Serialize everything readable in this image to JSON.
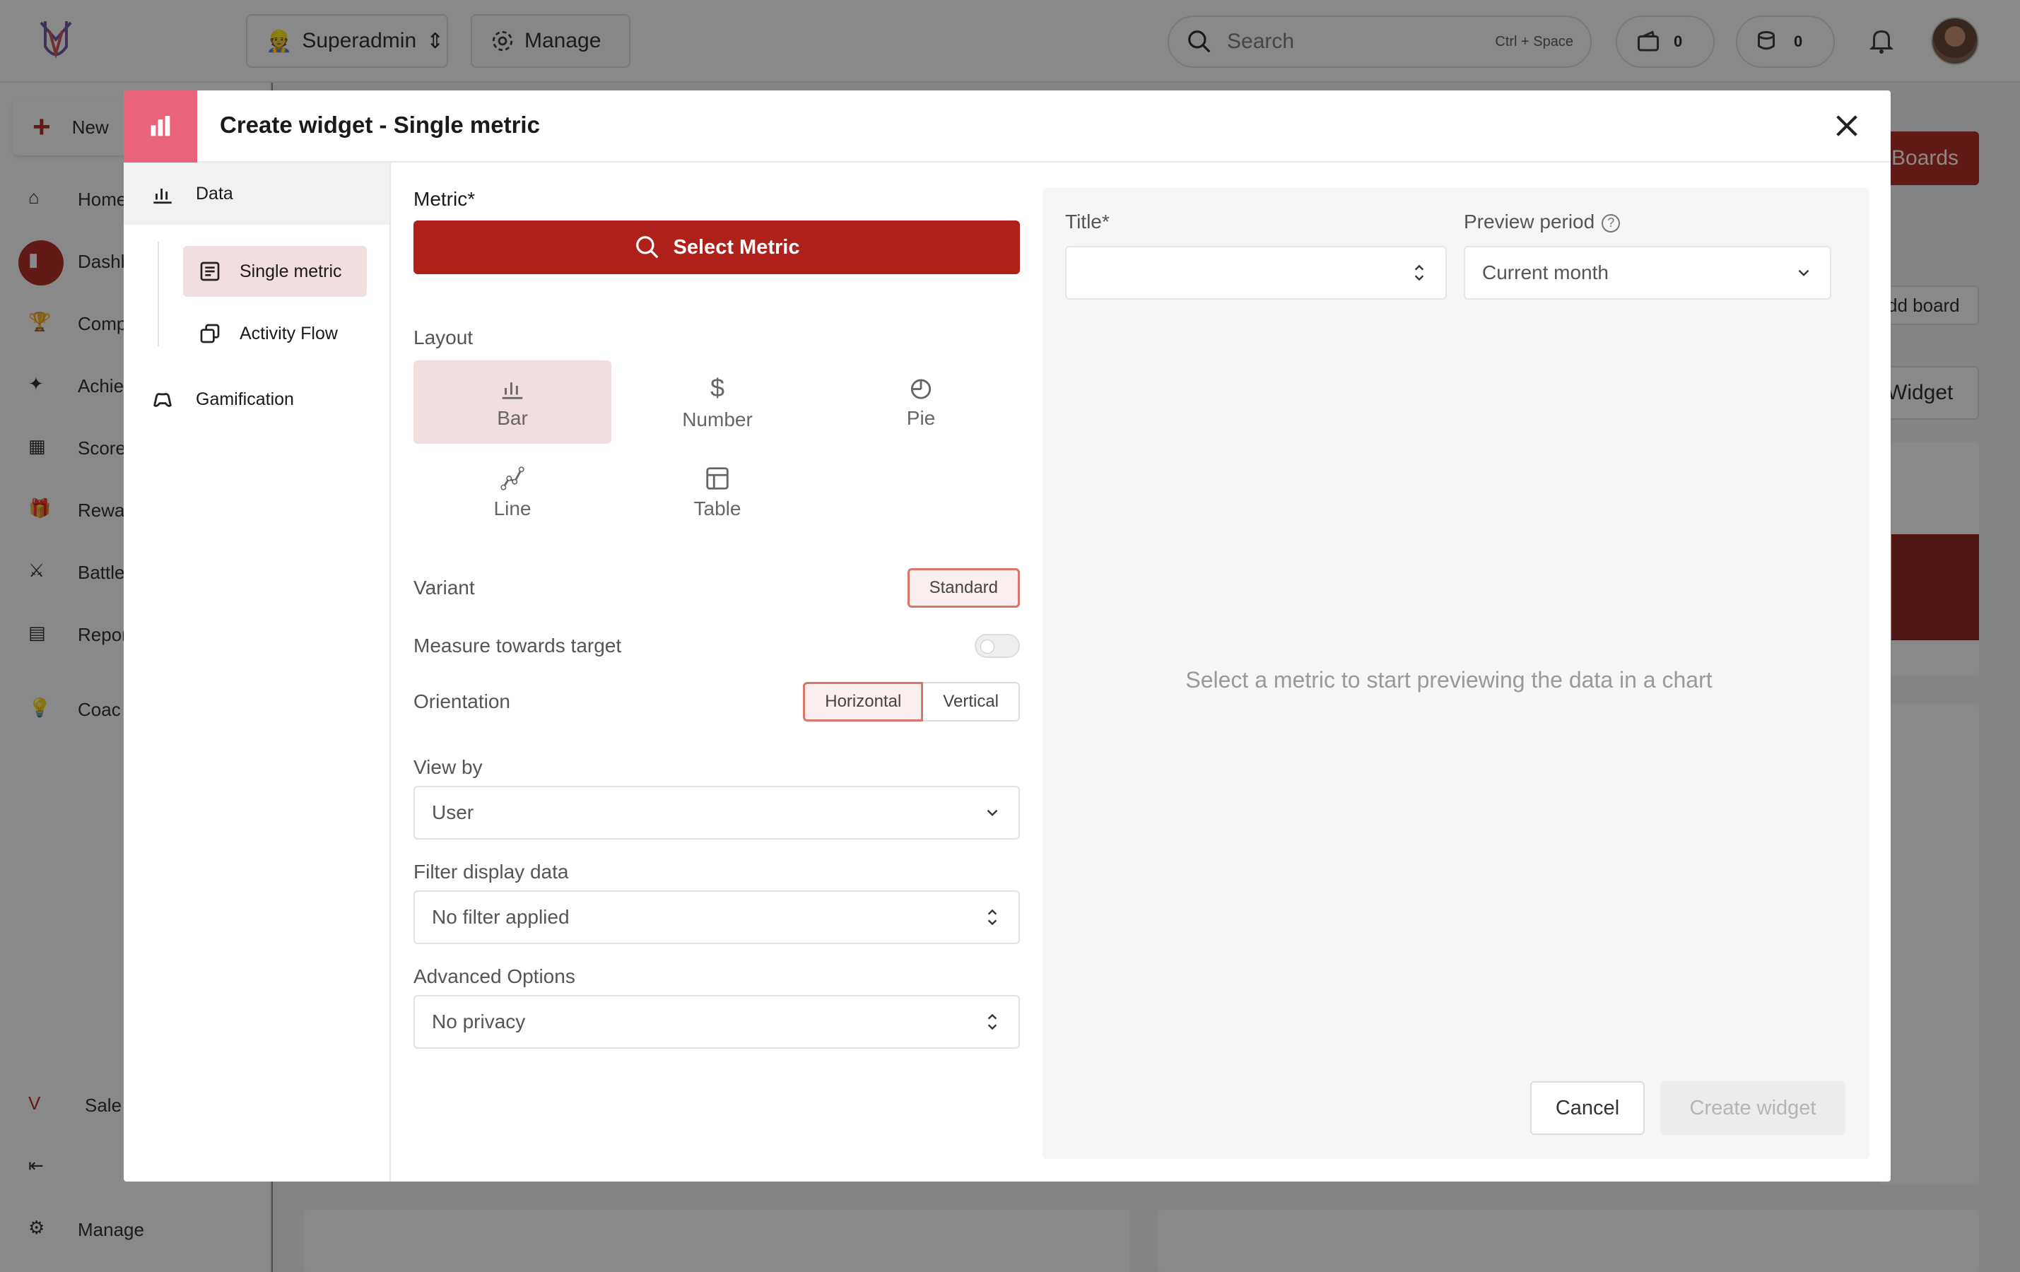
{
  "topbar": {
    "role_label": "Superadmin",
    "manage_label": "Manage",
    "search_placeholder": "Search",
    "search_shortcut": "Ctrl + Space",
    "wallet_count": "0",
    "coins_count": "0"
  },
  "sidebar": {
    "new_label": "New",
    "items": [
      {
        "label": "Home",
        "icon": "home-icon"
      },
      {
        "label": "Dashb",
        "icon": "dashboard-icon"
      },
      {
        "label": "Comp",
        "icon": "trophy-icon"
      },
      {
        "label": "Achie",
        "icon": "party-icon"
      },
      {
        "label": "Score",
        "icon": "scoreboard-icon"
      },
      {
        "label": "Rewa",
        "icon": "gift-icon"
      },
      {
        "label": "Battle",
        "icon": "swords-icon"
      },
      {
        "label": "Repor",
        "icon": "report-icon"
      },
      {
        "label": "Coac",
        "icon": "bulb-icon"
      }
    ],
    "bottom": {
      "sales_label": "Sale",
      "manage_label": "Manage"
    }
  },
  "background": {
    "boards_btn": "Boards",
    "add_board_btn": "dd board",
    "widget_btn": "Widget"
  },
  "modal": {
    "title": "Create widget - Single metric",
    "nav": {
      "data_label": "Data",
      "single_metric_label": "Single metric",
      "activity_flow_label": "Activity Flow",
      "gamification_label": "Gamification"
    },
    "form": {
      "metric_label": "Metric*",
      "select_metric_btn": "Select Metric",
      "layout_label": "Layout",
      "layouts": [
        "Bar",
        "Number",
        "Pie",
        "Line",
        "Table"
      ],
      "selected_layout": "Bar",
      "variant_label": "Variant",
      "variant_value": "Standard",
      "measure_label": "Measure towards target",
      "measure_on": false,
      "orientation_label": "Orientation",
      "orientation_options": [
        "Horizontal",
        "Vertical"
      ],
      "orientation_selected": "Horizontal",
      "view_by_label": "View by",
      "view_by_value": "User",
      "filter_label": "Filter display data",
      "filter_value": "No filter applied",
      "advanced_label": "Advanced Options",
      "advanced_value": "No privacy"
    },
    "preview": {
      "title_label": "Title*",
      "title_value": "",
      "period_label": "Preview period",
      "period_value": "Current month",
      "empty_text": "Select a metric to start previewing the data in a chart",
      "cancel_btn": "Cancel",
      "create_btn": "Create widget"
    }
  },
  "colors": {
    "accent": "#b0201a",
    "header_icon_bg": "#e9647a",
    "selected_bg": "#f1dede"
  }
}
